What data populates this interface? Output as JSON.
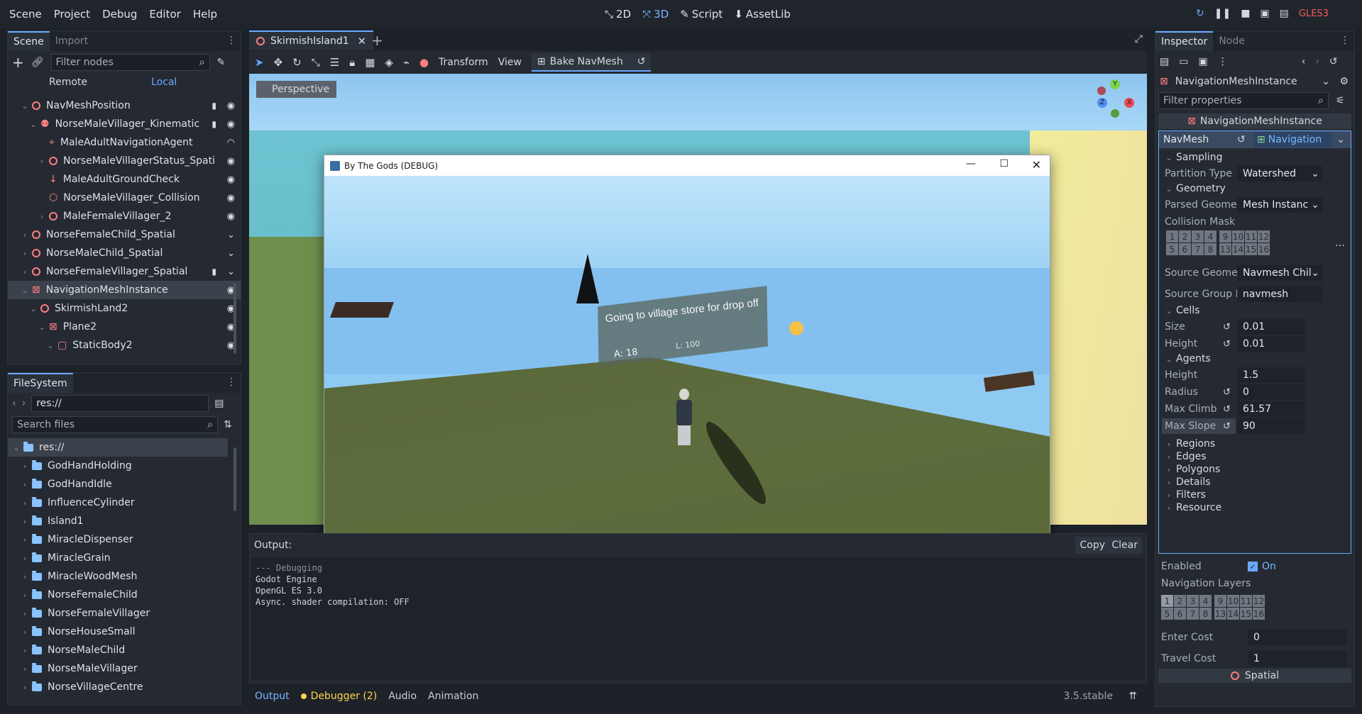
{
  "menu": [
    "Scene",
    "Project",
    "Debug",
    "Editor",
    "Help"
  ],
  "modes": [
    {
      "icon": "2d-icon",
      "label": "2D"
    },
    {
      "icon": "3d-icon",
      "label": "3D"
    },
    {
      "icon": "script-icon",
      "label": "Script"
    },
    {
      "icon": "assetlib-icon",
      "label": "AssetLib"
    }
  ],
  "renderer": "GLES3",
  "scene_dock": {
    "tabs": [
      "Scene",
      "Import"
    ],
    "filter_placeholder": "Filter nodes",
    "remote": "Remote",
    "local": "Local",
    "nodes": [
      {
        "label": "NavMeshPosition"
      },
      {
        "label": "NorseMaleVillager_Kinematic"
      },
      {
        "label": "MaleAdultNavigationAgent"
      },
      {
        "label": "NorseMaleVillagerStatus_Spati"
      },
      {
        "label": "MaleAdultGroundCheck"
      },
      {
        "label": "NorseMaleVillager_Collision"
      },
      {
        "label": "MaleFemaleVillager_2"
      },
      {
        "label": "NorseFemaleChild_Spatial"
      },
      {
        "label": "NorseMaleChild_Spatial"
      },
      {
        "label": "NorseFemaleVillager_Spatial"
      },
      {
        "label": "NavigationMeshInstance"
      },
      {
        "label": "SkirmishLand2"
      },
      {
        "label": "Plane2"
      },
      {
        "label": "StaticBody2"
      }
    ]
  },
  "filesystem": {
    "title": "FileSystem",
    "path": "res://",
    "search_placeholder": "Search files",
    "root": "res://",
    "folders": [
      "GodHandHolding",
      "GodHandIdle",
      "InfluenceCylinder",
      "Island1",
      "MiracleDispenser",
      "MiracleGrain",
      "MiracleWoodMesh",
      "NorseFemaleChild",
      "NorseFemaleVillager",
      "NorseHouseSmall",
      "NorseMaleChild",
      "NorseMaleVillager",
      "NorseVillageCentre"
    ]
  },
  "editor": {
    "scene_tab": "SkirmishIsland1",
    "toolbar": {
      "transform": "Transform",
      "view": "View",
      "bake": "Bake NavMesh"
    },
    "perspective": "Perspective"
  },
  "game_window": {
    "title": "By The Gods (DEBUG)",
    "banner": "Going to village store for drop off",
    "stat_a": "A: 18",
    "stat_l": "L: 100"
  },
  "output": {
    "label": "Output:",
    "copy": "Copy",
    "clear": "Clear",
    "lines": [
      "--- Debugging",
      "Godot Engine",
      "OpenGL ES 3.0",
      "Async. shader compilation: OFF"
    ]
  },
  "bottom_bar": {
    "tabs": [
      "Output",
      "Debugger (2)",
      "Audio",
      "Animation"
    ],
    "version": "3.5.stable"
  },
  "inspector": {
    "tabs": [
      "Inspector",
      "Node"
    ],
    "object": "NavigationMeshInstance",
    "filter_placeholder": "Filter properties",
    "header": "NavigationMeshInstance",
    "navmesh_label": "NavMesh",
    "navmesh_value": "Navigation",
    "sampling": "Sampling",
    "partition_type_label": "Partition Type",
    "partition_type_value": "Watershed",
    "geometry": "Geometry",
    "parsed_geometry_label": "Parsed Geometry",
    "parsed_geometry_value": "Mesh Instanc",
    "collision_mask_label": "Collision Mask",
    "mask_row1": [
      "1",
      "2",
      "3",
      "4",
      "9",
      "10",
      "11",
      "12"
    ],
    "mask_row2": [
      "5",
      "6",
      "7",
      "8",
      "13",
      "14",
      "15",
      "16"
    ],
    "source_geometry_label": "Source Geometry",
    "source_geometry_value": "Navmesh Chil",
    "source_group_label": "Source Group Na",
    "source_group_value": "navmesh",
    "cells": "Cells",
    "size_label": "Size",
    "size_value": "0.01",
    "cell_height_label": "Height",
    "cell_height_value": "0.01",
    "agents": "Agents",
    "agent_height_label": "Height",
    "agent_height_value": "1.5",
    "radius_label": "Radius",
    "radius_value": "0",
    "max_climb_label": "Max Climb",
    "max_climb_value": "61.57",
    "max_slope_label": "Max Slope",
    "max_slope_value": "90",
    "collapsed_sections": [
      "Regions",
      "Edges",
      "Polygons",
      "Details",
      "Filters",
      "Resource"
    ],
    "enabled_label": "Enabled",
    "enabled_value": "On",
    "nav_layers_label": "Navigation Layers",
    "layers_row1": [
      "1",
      "2",
      "3",
      "4",
      "9",
      "10",
      "11",
      "12"
    ],
    "layers_row2": [
      "5",
      "6",
      "7",
      "8",
      "13",
      "14",
      "15",
      "16"
    ],
    "enter_cost_label": "Enter Cost",
    "enter_cost_value": "0",
    "travel_cost_label": "Travel Cost",
    "travel_cost_value": "1",
    "spatial": "Spatial"
  },
  "colors": {
    "accent": "#6aa9ff",
    "node_icon": "#fc7f7f",
    "folder": "#8ac4ff"
  }
}
